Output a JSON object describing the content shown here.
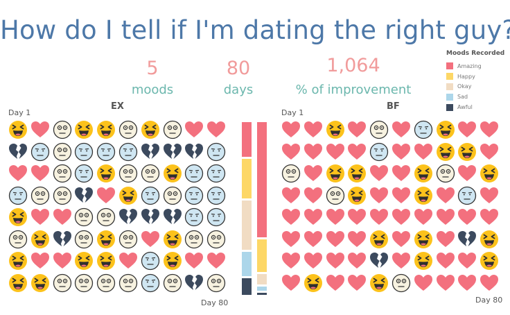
{
  "title": "How do I tell if I'm dating the right guy?",
  "stats": [
    {
      "value": "5",
      "label": "moods"
    },
    {
      "value": "80",
      "label": "days"
    },
    {
      "value": "1,064",
      "label": "% of improvement"
    }
  ],
  "legend": {
    "title": "Moods Recorded",
    "items": [
      {
        "label": "Amazing",
        "color": "#f3707e"
      },
      {
        "label": "Happy",
        "color": "#fdd766"
      },
      {
        "label": "Okay",
        "color": "#f1dcc3"
      },
      {
        "label": "Sad",
        "color": "#acd6ea"
      },
      {
        "label": "Awful",
        "color": "#3c4a5e"
      }
    ]
  },
  "icons": {
    "A": "heart-icon",
    "H": "laughing-face-icon",
    "O": "neutral-face-icon",
    "S": "sad-face-icon",
    "W": "broken-heart-icon"
  },
  "ex": {
    "title": "EX",
    "start_label": "Day 1",
    "end_label": "Day 80",
    "rows": [
      [
        "H",
        "A",
        "O",
        "H",
        "H",
        "O",
        "H",
        "O",
        "A",
        "A"
      ],
      [
        "W",
        "S",
        "O",
        "S",
        "S",
        "S",
        "W",
        "W",
        "W",
        "S"
      ],
      [
        "A",
        "A",
        "O",
        "S",
        "H",
        "O",
        "O",
        "H",
        "S",
        "S"
      ],
      [
        "S",
        "O",
        "O",
        "W",
        "A",
        "H",
        "S",
        "O",
        "S",
        "S"
      ],
      [
        "H",
        "A",
        "A",
        "O",
        "O",
        "W",
        "W",
        "W",
        "S",
        "S"
      ],
      [
        "O",
        "H",
        "W",
        "O",
        "H",
        "O",
        "A",
        "H",
        "O",
        "O"
      ],
      [
        "H",
        "A",
        "A",
        "H",
        "H",
        "A",
        "S",
        "H",
        "A",
        "A"
      ],
      [
        "H",
        "H",
        "O",
        "O",
        "O",
        "O",
        "S",
        "O",
        "W",
        "O"
      ]
    ],
    "counts": {
      "Amazing": 17,
      "Happy": 19,
      "Okay": 24,
      "Sad": 12,
      "Awful": 8
    }
  },
  "bf": {
    "title": "BF",
    "start_label": "Day 1",
    "end_label": "Day 80",
    "rows": [
      [
        "A",
        "A",
        "H",
        "A",
        "O",
        "A",
        "S",
        "H",
        "A",
        "A"
      ],
      [
        "A",
        "A",
        "A",
        "A",
        "S",
        "A",
        "A",
        "H",
        "H",
        "A"
      ],
      [
        "O",
        "A",
        "H",
        "H",
        "A",
        "A",
        "H",
        "O",
        "A",
        "H"
      ],
      [
        "A",
        "A",
        "O",
        "H",
        "A",
        "A",
        "H",
        "A",
        "S",
        "A"
      ],
      [
        "A",
        "A",
        "A",
        "A",
        "A",
        "A",
        "A",
        "A",
        "A",
        "A"
      ],
      [
        "A",
        "A",
        "A",
        "A",
        "H",
        "A",
        "H",
        "A",
        "W",
        "H"
      ],
      [
        "A",
        "A",
        "A",
        "A",
        "W",
        "A",
        "H",
        "A",
        "A",
        "H"
      ],
      [
        "A",
        "H",
        "A",
        "A",
        "H",
        "O",
        "A",
        "A",
        "A",
        "A"
      ]
    ],
    "counts": {
      "Amazing": 56,
      "Happy": 16,
      "Okay": 5,
      "Sad": 2,
      "Awful": 1
    }
  }
}
